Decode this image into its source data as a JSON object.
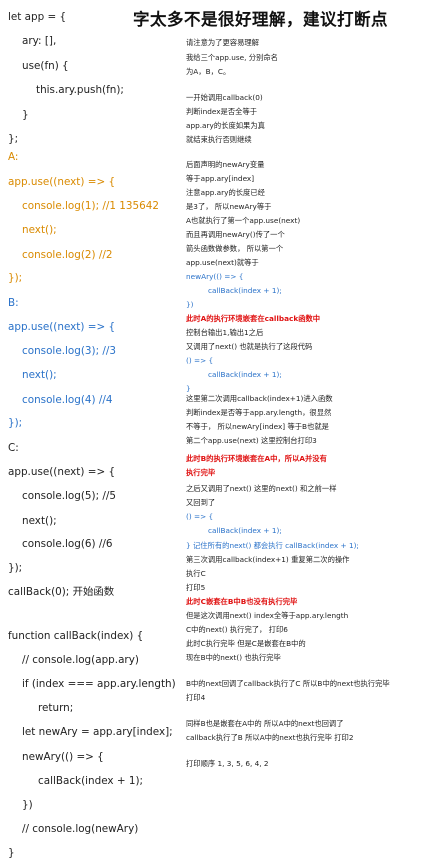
{
  "title": "字太多不是很好理解，建议打断点",
  "code_lines": [
    {
      "text": "let app = {",
      "color": "dark"
    },
    {
      "text": "ary: [],",
      "color": "dark"
    },
    {
      "text": "use(fn) {",
      "color": "dark"
    },
    {
      "text": "this.ary.push(fn);",
      "color": "dark"
    },
    {
      "text": "}",
      "color": "dark"
    },
    {
      "text": "};",
      "color": "dark"
    },
    {
      "text": "A:",
      "color": "orange"
    },
    {
      "text": "app.use((next) => {",
      "color": "orange"
    },
    {
      "text": "console.log(1); //1 135642",
      "color": "orange"
    },
    {
      "text": "next();",
      "color": "orange"
    },
    {
      "text": "console.log(2) //2",
      "color": "orange"
    },
    {
      "text": "});",
      "color": "orange"
    },
    {
      "text": "B:",
      "color": "blue"
    },
    {
      "text": "app.use((next) => {",
      "color": "blue"
    },
    {
      "text": "console.log(3); //3",
      "color": "blue"
    },
    {
      "text": "next();",
      "color": "blue"
    },
    {
      "text": "console.log(4) //4",
      "color": "blue"
    },
    {
      "text": "});",
      "color": "blue"
    },
    {
      "text": "C:",
      "color": "dark"
    },
    {
      "text": "app.use((next) => {",
      "color": "dark"
    },
    {
      "text": "console.log(5); //5",
      "color": "dark"
    },
    {
      "text": "next();",
      "color": "dark"
    },
    {
      "text": "console.log(6) //6",
      "color": "dark"
    },
    {
      "text": "});",
      "color": "dark"
    },
    {
      "text": "callBack(0); 开始函数",
      "color": "dark"
    },
    {
      "text": "function callBack(index) {",
      "color": "dark"
    },
    {
      "text": "// console.log(app.ary)",
      "color": "dark"
    },
    {
      "text": "if (index === app.ary.length)",
      "color": "dark"
    },
    {
      "text": "return;",
      "color": "dark"
    },
    {
      "text": "let newAry = app.ary[index];",
      "color": "dark"
    },
    {
      "text": "newAry(() => {",
      "color": "dark"
    },
    {
      "text": "callBack(index + 1);",
      "color": "dark"
    },
    {
      "text": "})",
      "color": "dark"
    },
    {
      "text": "// console.log(newAry)",
      "color": "dark"
    },
    {
      "text": "}",
      "color": "dark"
    }
  ],
  "notes": [
    {
      "text": "请注意为了更容易理解",
      "style": "normal"
    },
    {
      "text": "我给三个app.use, 分别命名",
      "style": "normal"
    },
    {
      "text": "为A，B，C。",
      "style": "normal"
    },
    {
      "text": "一开始调用callback(0)",
      "style": "normal"
    },
    {
      "text": "判断index是否全等于",
      "style": "normal"
    },
    {
      "text": "app.ary的长度如果为真",
      "style": "normal"
    },
    {
      "text": "就结束执行否则继续",
      "style": "normal"
    },
    {
      "text": "后面声明的newAry变量",
      "style": "normal"
    },
    {
      "text": "等于app.ary[index]",
      "style": "normal"
    },
    {
      "text": "注意app.ary的长度已经",
      "style": "normal"
    },
    {
      "text": "是3了，  所以newAry等于",
      "style": "normal"
    },
    {
      "text": "A也就执行了第一个app.use(next)",
      "style": "normal"
    },
    {
      "text": "而且再调用newAry()传了一个",
      "style": "normal"
    },
    {
      "text": "箭头函数做参数，  所以第一个",
      "style": "normal"
    },
    {
      "text": "app.use(next)就等于",
      "style": "normal"
    },
    {
      "text": "newAry(() => {",
      "style": "blue"
    },
    {
      "text": "callBack(index + 1);",
      "style": "blue"
    },
    {
      "text": "})",
      "style": "blue"
    },
    {
      "text": "此时A的执行环境嵌套在callback函数中",
      "style": "red"
    },
    {
      "text": "控制台输出1,输出1之后",
      "style": "normal"
    },
    {
      "text": "又调用了next() 也就是执行了这段代码",
      "style": "normal"
    },
    {
      "text": "() => {",
      "style": "blue"
    },
    {
      "text": "callBack(index + 1);",
      "style": "blue"
    },
    {
      "text": "}",
      "style": "blue"
    },
    {
      "text": "这里第二次调用callback(index+1)进入函数",
      "style": "normal"
    },
    {
      "text": "判断index是否等于app.ary.length，很显然",
      "style": "normal"
    },
    {
      "text": "不等于，  所以newAry[index] 等于B也就是",
      "style": "normal"
    },
    {
      "text": "第二个app.use(next) 这里控制台打印3",
      "style": "normal"
    },
    {
      "text": "此时B的执行环境嵌套在A中，所以A并没有",
      "style": "red"
    },
    {
      "text": "执行完毕",
      "style": "red"
    },
    {
      "text": "之后又调用了next() 这里的next() 和之前一样",
      "style": "normal"
    },
    {
      "text": "又回到了",
      "style": "normal"
    },
    {
      "text": "() => {",
      "style": "blue"
    },
    {
      "text": "callBack(index + 1);",
      "style": "blue"
    },
    {
      "text": "} 记住所有的next() 都会执行 callBack(index + 1);",
      "style": "blue"
    },
    {
      "text": "第三次调用callback(index+1) 重复第二次的操作",
      "style": "normal"
    },
    {
      "text": "执行C",
      "style": "normal"
    },
    {
      "text": "打印5",
      "style": "normal"
    },
    {
      "text": "此时C嵌套在B中B也没有执行完毕",
      "style": "red"
    },
    {
      "text": "但是这次调用next() index全等于app.ary.length",
      "style": "normal"
    },
    {
      "text": "C中的next() 执行完了，  打印6",
      "style": "normal"
    },
    {
      "text": "此时C执行完毕 但是C是嵌套在B中的",
      "style": "normal"
    },
    {
      "text": "现在B中的next() 也执行完毕",
      "style": "normal"
    },
    {
      "text": "B中的next回调了callback执行了C 所以B中的next也执行完毕",
      "style": "normal"
    },
    {
      "text": "打印4",
      "style": "normal"
    },
    {
      "text": "同样B也是嵌套在A中的 所以A中的next也回调了",
      "style": "normal"
    },
    {
      "text": "callback执行了B 所以A中的next也执行完毕 打印2",
      "style": "normal"
    },
    {
      "text": "打印顺序  1, 3, 5, 6, 4, 2",
      "style": "normal"
    }
  ]
}
